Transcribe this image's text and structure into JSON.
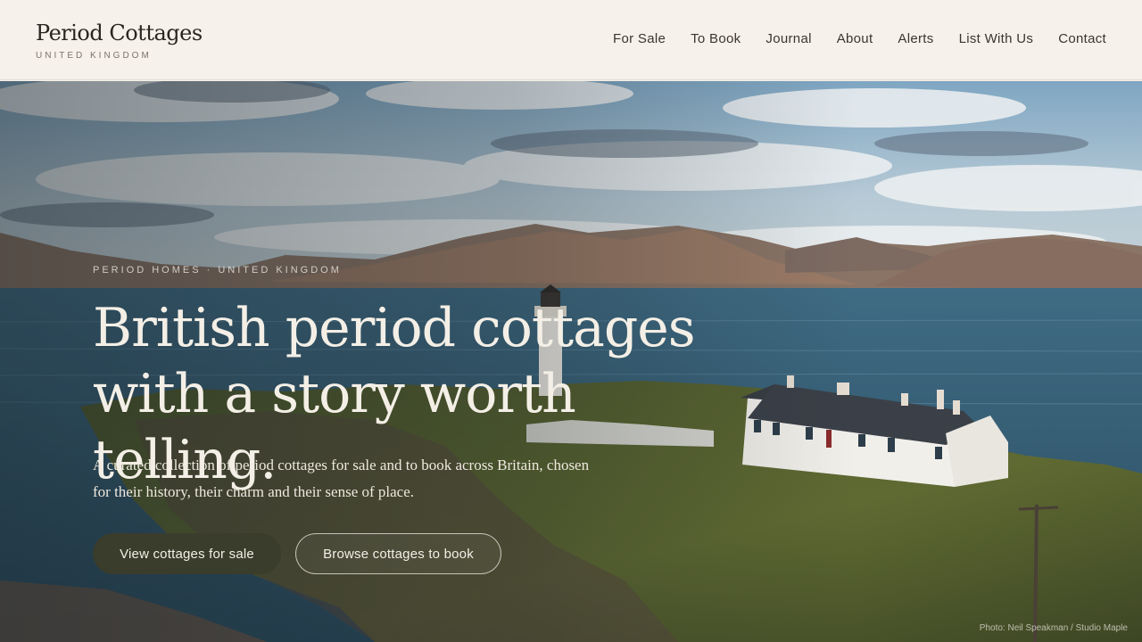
{
  "header": {
    "brand_name": "Period Cottages",
    "brand_sub": "UNITED KINGDOM",
    "nav": [
      "For Sale",
      "To Book",
      "Journal",
      "About",
      "Alerts",
      "List With Us",
      "Contact"
    ]
  },
  "hero": {
    "eyebrow": "PERIOD HOMES · UNITED KINGDOM",
    "headline_line1": "British period cottages",
    "headline_line2": "with a story worth telling.",
    "lede": "A curated collection of period cottages for sale and to book across Britain, chosen for their history, their charm and their sense of place.",
    "primary_cta": "View cottages for sale",
    "secondary_cta": "Browse cottages to book",
    "photo_credit": "Photo: Neil Speakman / Studio Maple"
  },
  "colors": {
    "page_bg": "#f6f1ea",
    "primary_button": "#3a3d2c",
    "headline_text": "#f4efe6"
  }
}
